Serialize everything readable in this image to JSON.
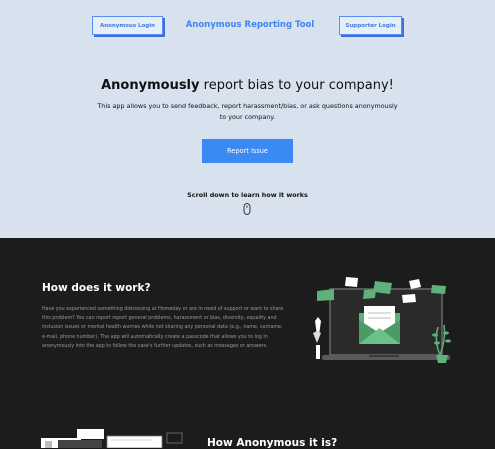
{
  "nav": {
    "left_button": "Anonymous Login",
    "title": "Anonymous Reporting Tool",
    "right_button": "Supporter Login"
  },
  "hero": {
    "headline_bold": "Anonymously",
    "headline_rest": " report bias to your company!",
    "subtext": "This app allows you to send feedback, report harassment/bias, or ask questions anonymously to your company.",
    "cta_button": "Report Issue",
    "scroll_hint": "Scroll down to learn how it works"
  },
  "how": {
    "title": "How does it work?",
    "body": "Have you experienced something distressing at Homeday or are in need of support or want to share this problem? You can report report general problems, harassment or bias, diversity, equality and inclusion issues or mental health worries while not sharing any personal data (e.g., name, surname, e-mail, phone number). The app will automatically create a passcode that allows you to log in anonymously into the app to follow the case's further updates, such as messages or answers."
  },
  "anonymous": {
    "title": "How Anonymous it is?"
  },
  "icons": [
    "mouse-icon",
    "laptop-envelope-illustration",
    "plant-illustration",
    "documents-illustration"
  ],
  "colors": {
    "accent": "#3b89f2",
    "hero_bg": "#d8e2ee",
    "dark_bg": "#1c1c1c",
    "illustration_green": "#5fb07a"
  }
}
